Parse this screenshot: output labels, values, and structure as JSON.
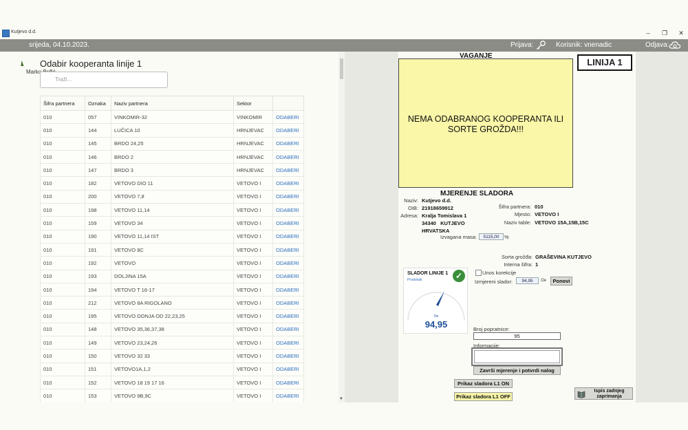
{
  "window": {
    "title": "Kutjevo d.d.",
    "controls": [
      "–",
      "❐",
      "✕"
    ]
  },
  "header": {
    "date": "srijeda, 04.10.2023.",
    "prijava_label": "Prijava:",
    "korisnik_label": "Korisnik: vnenadic",
    "odjava_label": "Odjava:"
  },
  "left": {
    "user": "Marko Brđić",
    "title": "Odabir kooperanta linije 1",
    "search_placeholder": "Traži...",
    "columns": [
      "Šifra partnera",
      "Oznaka",
      "Naziv partnera",
      "Sektor",
      ""
    ],
    "rows": [
      [
        "010",
        "057",
        "VINKOMIR-32",
        "VINKOMIR",
        "ODABERI"
      ],
      [
        "010",
        "144",
        "LUČICA 10",
        "HRNJEVAC",
        "ODABERI"
      ],
      [
        "010",
        "145",
        "BRDO 24,25",
        "HRNJEVAC",
        "ODABERI"
      ],
      [
        "010",
        "146",
        "BRDO 2",
        "HRNJEVAC",
        "ODABERI"
      ],
      [
        "010",
        "147",
        "BRDO 3",
        "HRNJEVAC",
        "ODABERI"
      ],
      [
        "010",
        "182",
        "VETOVO DIO 11",
        "VETOVO I",
        "ODABERI"
      ],
      [
        "010",
        "200",
        "VETOVO 7,8",
        "VETOVO I",
        "ODABERI"
      ],
      [
        "010",
        "198",
        "VETOVO 11,14",
        "VETOVO I",
        "ODABERI"
      ],
      [
        "010",
        "159",
        "VETOVO 34",
        "VETOVO I",
        "ODABERI"
      ],
      [
        "010",
        "190",
        "VETOVO 11,14 IST",
        "VETOVO I",
        "ODABERI"
      ],
      [
        "010",
        "191",
        "VETOVO 8C",
        "VETOVO I",
        "ODABERI"
      ],
      [
        "010",
        "192",
        "VETOVO",
        "VETOVO I",
        "ODABERI"
      ],
      [
        "010",
        "193",
        "DOLJINA 15A",
        "VETOVO I",
        "ODABERI"
      ],
      [
        "010",
        "194",
        "VETOVO T 16-17",
        "VETOVO I",
        "ODABERI"
      ],
      [
        "010",
        "212",
        "VETOVO 8A RIGOLANO",
        "VETOVO I",
        "ODABERI"
      ],
      [
        "010",
        "195",
        "VETOVO DONJA OD 22,23,25",
        "VETOVO I",
        "ODABERI"
      ],
      [
        "010",
        "148",
        "VETOVO 35,36,37,38",
        "VETOVO I",
        "ODABERI"
      ],
      [
        "010",
        "149",
        "VETOVO 23,24,26",
        "VETOVO I",
        "ODABERI"
      ],
      [
        "010",
        "150",
        "VETOVO 32 33",
        "VETOVO I",
        "ODABERI"
      ],
      [
        "010",
        "151",
        "VETOVO1A,1,2",
        "VETOVO I",
        "ODABERI"
      ],
      [
        "010",
        "152",
        "VETOVO 18 19 17 16",
        "VETOVO I",
        "ODABERI"
      ],
      [
        "010",
        "153",
        "VETOVO 9B,9C",
        "VETOVO I",
        "ODABERI"
      ]
    ]
  },
  "right": {
    "vaganje_title": "VAGANJE",
    "linija": "LINIJA 1",
    "no_selection_msg": "NEMA ODABRANOG KOOPERANTA ILI SORTE GROŽDA!!!",
    "mjerenje_title": "MJERENJE SLADORA",
    "naziv_label": "Naziv:",
    "naziv": "Kutjevo d.d.",
    "oib_label": "OIB:",
    "oib": "21918659912",
    "adresa_label": "Adresa:",
    "adresa_1": "Kralja Tomislava 1",
    "adresa_2": "34340   KUTJEVO",
    "adresa_3": "HRVATSKA",
    "sifra_label": "Šifra partnera:",
    "sifra": "010",
    "mjesto_label": "Mjesto:",
    "mjesto": "VETOVO I",
    "tabla_label": "Naziv table:",
    "tabla": "VETOVO 15A,15B,15C",
    "masa_label": "Izvagana masa:",
    "masa": "5115,00",
    "masa_unit": "%",
    "sorta_label": "Sorta grožđa:",
    "sorta": "GRAŠEVINA KUTJEVO",
    "sifra_int_label": "Interna šifra:",
    "sifra_int": "1",
    "gauge_title": "SLADOR LINIJE 1",
    "gauge_sub": "Postotak",
    "gauge_unit": "Oe",
    "gauge_value": "94,95",
    "unos_korekcije": "Unos korekcije",
    "izmjereni_label": "Izmjereni slador:",
    "izmjereni": "94,95",
    "izmjereni_unit": "Oe",
    "ponovi": "Ponovi",
    "broj_label": "Broj popratnice:",
    "broj": "95",
    "informacije_label": "Informacije:",
    "zavrsi": "Završi mjerenje i potvrdi nalog",
    "prikaz_on": "Prikaz sladora L1 ON",
    "prikaz_off": "Prikaz sladora L1 OFF",
    "ispis": "Ispis zadnjeg zaprimanja",
    "colors": {
      "yellow": "#faf7a8",
      "header": "#8c8c87",
      "link": "#2f6fbf",
      "gauge": "#1f4f9a",
      "ok": "#3a8f3a"
    }
  }
}
